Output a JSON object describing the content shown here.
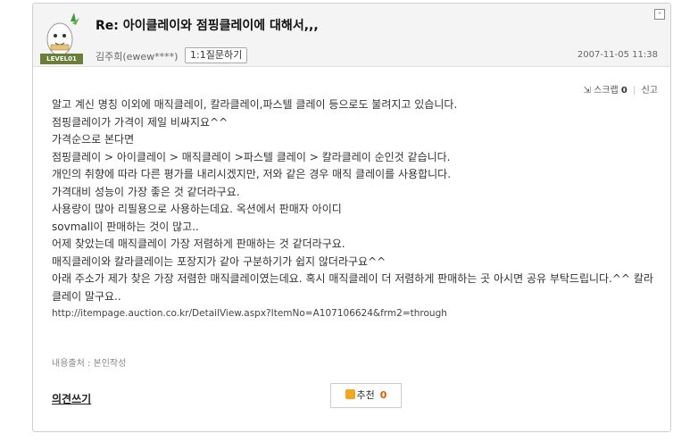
{
  "post": {
    "title": "Re: 아이클레이와 점핑클레이에 대해서,,,",
    "level": "LEVEL01",
    "author": "김주희(ewew****)",
    "qa_button": "1:1질문하기",
    "date": "2007-11-05 11:38",
    "collapse": "-",
    "scrap_label": "스크랩",
    "scrap_count": "0",
    "report_label": "신고",
    "lines": [
      "알고 계신 명칭 이외에 매직클레이, 칼라클레이,파스텔 클레이 등으로도 불려지고 있습니다.",
      "점핑클레이가 가격이 제일 비싸지요^^",
      "가격순으로 본다면",
      "점핑클레이 > 아이클레이 > 매직클레이 >파스텔 클레이 > 칼라클레이 순인것 같습니다.",
      "개인의 취향에 따라 다른 평가를 내리시겠지만, 저와 같은 경우 매직 클레이를 사용합니다.",
      "가격대비 성능이 가장 좋은 것 같더라구요.",
      "사용량이 많아 리필용으로 사용하는데요. 옥션에서 판매자 아이디",
      "sovmall이 판매하는 것이 많고..",
      "어제 찾았는데 매직클레이 가장 저렴하게 판매하는 것 같더라구요.",
      "매직클레이와 칼라클레이는 포장지가 같아 구분하기가 쉽지 않더라구요^^",
      "아래 주소가 제가 찾은 가장 저렴한 매직클레이였는데요. 혹시 매직클레이 더 저렴하게 판매하는 곳 아시면 공유 부탁드립니다.^^ 칼라 클레이 말구요.."
    ],
    "url": "http://itempage.auction.co.kr/DetailView.aspx?ItemNo=A107106624&frm2=through",
    "source": "내용출처 : 본인작성",
    "comment_link": "의견쓰기",
    "recommend_label": "추천",
    "recommend_count": "0"
  }
}
